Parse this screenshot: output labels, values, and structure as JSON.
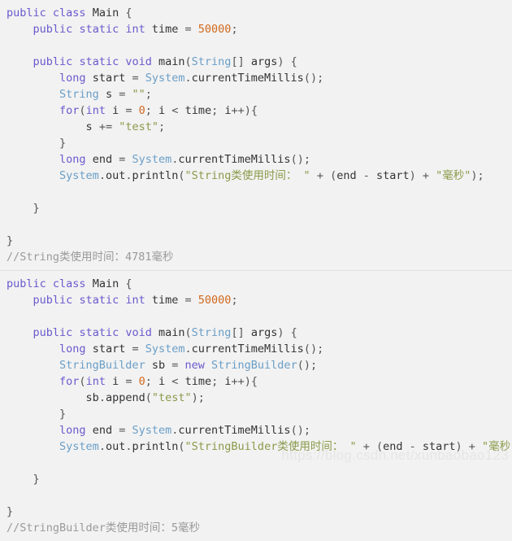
{
  "page": {
    "background_color": "#f2f2f2",
    "watermark": "https://blog.csdn.net/xunbaobao123"
  },
  "colors": {
    "keyword": "#6a5acd",
    "class_name": "#6a9ec7",
    "identifier": "#333333",
    "number": "#d2691e",
    "string": "#8a9a4a",
    "comment": "#9a9a9a",
    "punctuation": "#555555",
    "separator": "#e0e0e0"
  },
  "blocks": [
    {
      "id": "string-concat-example",
      "language": "java",
      "lines": [
        [
          {
            "t": "public",
            "c": "kw"
          },
          {
            "t": " ",
            "c": "pun"
          },
          {
            "t": "class",
            "c": "kw"
          },
          {
            "t": " ",
            "c": "pun"
          },
          {
            "t": "Main",
            "c": "id"
          },
          {
            "t": " {",
            "c": "pun"
          }
        ],
        [
          {
            "t": "    ",
            "c": "pun"
          },
          {
            "t": "public",
            "c": "kw"
          },
          {
            "t": " ",
            "c": "pun"
          },
          {
            "t": "static",
            "c": "kw"
          },
          {
            "t": " ",
            "c": "pun"
          },
          {
            "t": "int",
            "c": "kw"
          },
          {
            "t": " ",
            "c": "pun"
          },
          {
            "t": "time",
            "c": "id"
          },
          {
            "t": " = ",
            "c": "pun"
          },
          {
            "t": "50000",
            "c": "num"
          },
          {
            "t": ";",
            "c": "pun"
          }
        ],
        [
          {
            "t": "",
            "c": "pun"
          }
        ],
        [
          {
            "t": "    ",
            "c": "pun"
          },
          {
            "t": "public",
            "c": "kw"
          },
          {
            "t": " ",
            "c": "pun"
          },
          {
            "t": "static",
            "c": "kw"
          },
          {
            "t": " ",
            "c": "pun"
          },
          {
            "t": "void",
            "c": "kw"
          },
          {
            "t": " ",
            "c": "pun"
          },
          {
            "t": "main",
            "c": "id"
          },
          {
            "t": "(",
            "c": "pun"
          },
          {
            "t": "String",
            "c": "cls"
          },
          {
            "t": "[] ",
            "c": "pun"
          },
          {
            "t": "args",
            "c": "id"
          },
          {
            "t": ") {",
            "c": "pun"
          }
        ],
        [
          {
            "t": "        ",
            "c": "pun"
          },
          {
            "t": "long",
            "c": "kw"
          },
          {
            "t": " ",
            "c": "pun"
          },
          {
            "t": "start",
            "c": "id"
          },
          {
            "t": " = ",
            "c": "pun"
          },
          {
            "t": "System",
            "c": "cls"
          },
          {
            "t": ".",
            "c": "pun"
          },
          {
            "t": "currentTimeMillis",
            "c": "id"
          },
          {
            "t": "();",
            "c": "pun"
          }
        ],
        [
          {
            "t": "        ",
            "c": "pun"
          },
          {
            "t": "String",
            "c": "cls"
          },
          {
            "t": " ",
            "c": "pun"
          },
          {
            "t": "s",
            "c": "id"
          },
          {
            "t": " = ",
            "c": "pun"
          },
          {
            "t": "\"\"",
            "c": "str"
          },
          {
            "t": ";",
            "c": "pun"
          }
        ],
        [
          {
            "t": "        ",
            "c": "pun"
          },
          {
            "t": "for",
            "c": "kw"
          },
          {
            "t": "(",
            "c": "pun"
          },
          {
            "t": "int",
            "c": "kw"
          },
          {
            "t": " ",
            "c": "pun"
          },
          {
            "t": "i",
            "c": "id"
          },
          {
            "t": " = ",
            "c": "pun"
          },
          {
            "t": "0",
            "c": "num"
          },
          {
            "t": "; ",
            "c": "pun"
          },
          {
            "t": "i",
            "c": "id"
          },
          {
            "t": " < ",
            "c": "pun"
          },
          {
            "t": "time",
            "c": "id"
          },
          {
            "t": "; ",
            "c": "pun"
          },
          {
            "t": "i",
            "c": "id"
          },
          {
            "t": "++){",
            "c": "pun"
          }
        ],
        [
          {
            "t": "            ",
            "c": "pun"
          },
          {
            "t": "s",
            "c": "id"
          },
          {
            "t": " += ",
            "c": "pun"
          },
          {
            "t": "\"test\"",
            "c": "str"
          },
          {
            "t": ";",
            "c": "pun"
          }
        ],
        [
          {
            "t": "        }",
            "c": "pun"
          }
        ],
        [
          {
            "t": "        ",
            "c": "pun"
          },
          {
            "t": "long",
            "c": "kw"
          },
          {
            "t": " ",
            "c": "pun"
          },
          {
            "t": "end",
            "c": "id"
          },
          {
            "t": " = ",
            "c": "pun"
          },
          {
            "t": "System",
            "c": "cls"
          },
          {
            "t": ".",
            "c": "pun"
          },
          {
            "t": "currentTimeMillis",
            "c": "id"
          },
          {
            "t": "();",
            "c": "pun"
          }
        ],
        [
          {
            "t": "        ",
            "c": "pun"
          },
          {
            "t": "System",
            "c": "cls"
          },
          {
            "t": ".",
            "c": "pun"
          },
          {
            "t": "out",
            "c": "id"
          },
          {
            "t": ".",
            "c": "pun"
          },
          {
            "t": "println",
            "c": "id"
          },
          {
            "t": "(",
            "c": "pun"
          },
          {
            "t": "\"String类使用时间： \"",
            "c": "str"
          },
          {
            "t": " + (",
            "c": "pun"
          },
          {
            "t": "end",
            "c": "id"
          },
          {
            "t": " - ",
            "c": "pun"
          },
          {
            "t": "start",
            "c": "id"
          },
          {
            "t": ") + ",
            "c": "pun"
          },
          {
            "t": "\"毫秒\"",
            "c": "str"
          },
          {
            "t": ");",
            "c": "pun"
          }
        ],
        [
          {
            "t": "",
            "c": "pun"
          }
        ],
        [
          {
            "t": "    }",
            "c": "pun"
          }
        ],
        [
          {
            "t": "",
            "c": "pun"
          }
        ],
        [
          {
            "t": "}",
            "c": "pun"
          }
        ],
        [
          {
            "t": "//String类使用时间：4781毫秒",
            "c": "cmt"
          }
        ]
      ]
    },
    {
      "id": "stringbuilder-example",
      "language": "java",
      "lines": [
        [
          {
            "t": "public",
            "c": "kw"
          },
          {
            "t": " ",
            "c": "pun"
          },
          {
            "t": "class",
            "c": "kw"
          },
          {
            "t": " ",
            "c": "pun"
          },
          {
            "t": "Main",
            "c": "id"
          },
          {
            "t": " {",
            "c": "pun"
          }
        ],
        [
          {
            "t": "    ",
            "c": "pun"
          },
          {
            "t": "public",
            "c": "kw"
          },
          {
            "t": " ",
            "c": "pun"
          },
          {
            "t": "static",
            "c": "kw"
          },
          {
            "t": " ",
            "c": "pun"
          },
          {
            "t": "int",
            "c": "kw"
          },
          {
            "t": " ",
            "c": "pun"
          },
          {
            "t": "time",
            "c": "id"
          },
          {
            "t": " = ",
            "c": "pun"
          },
          {
            "t": "50000",
            "c": "num"
          },
          {
            "t": ";",
            "c": "pun"
          }
        ],
        [
          {
            "t": "",
            "c": "pun"
          }
        ],
        [
          {
            "t": "    ",
            "c": "pun"
          },
          {
            "t": "public",
            "c": "kw"
          },
          {
            "t": " ",
            "c": "pun"
          },
          {
            "t": "static",
            "c": "kw"
          },
          {
            "t": " ",
            "c": "pun"
          },
          {
            "t": "void",
            "c": "kw"
          },
          {
            "t": " ",
            "c": "pun"
          },
          {
            "t": "main",
            "c": "id"
          },
          {
            "t": "(",
            "c": "pun"
          },
          {
            "t": "String",
            "c": "cls"
          },
          {
            "t": "[] ",
            "c": "pun"
          },
          {
            "t": "args",
            "c": "id"
          },
          {
            "t": ") {",
            "c": "pun"
          }
        ],
        [
          {
            "t": "        ",
            "c": "pun"
          },
          {
            "t": "long",
            "c": "kw"
          },
          {
            "t": " ",
            "c": "pun"
          },
          {
            "t": "start",
            "c": "id"
          },
          {
            "t": " = ",
            "c": "pun"
          },
          {
            "t": "System",
            "c": "cls"
          },
          {
            "t": ".",
            "c": "pun"
          },
          {
            "t": "currentTimeMillis",
            "c": "id"
          },
          {
            "t": "();",
            "c": "pun"
          }
        ],
        [
          {
            "t": "        ",
            "c": "pun"
          },
          {
            "t": "StringBuilder",
            "c": "cls"
          },
          {
            "t": " ",
            "c": "pun"
          },
          {
            "t": "sb",
            "c": "id"
          },
          {
            "t": " = ",
            "c": "pun"
          },
          {
            "t": "new",
            "c": "kw"
          },
          {
            "t": " ",
            "c": "pun"
          },
          {
            "t": "StringBuilder",
            "c": "cls"
          },
          {
            "t": "();",
            "c": "pun"
          }
        ],
        [
          {
            "t": "        ",
            "c": "pun"
          },
          {
            "t": "for",
            "c": "kw"
          },
          {
            "t": "(",
            "c": "pun"
          },
          {
            "t": "int",
            "c": "kw"
          },
          {
            "t": " ",
            "c": "pun"
          },
          {
            "t": "i",
            "c": "id"
          },
          {
            "t": " = ",
            "c": "pun"
          },
          {
            "t": "0",
            "c": "num"
          },
          {
            "t": "; ",
            "c": "pun"
          },
          {
            "t": "i",
            "c": "id"
          },
          {
            "t": " < ",
            "c": "pun"
          },
          {
            "t": "time",
            "c": "id"
          },
          {
            "t": "; ",
            "c": "pun"
          },
          {
            "t": "i",
            "c": "id"
          },
          {
            "t": "++){",
            "c": "pun"
          }
        ],
        [
          {
            "t": "            ",
            "c": "pun"
          },
          {
            "t": "sb",
            "c": "id"
          },
          {
            "t": ".",
            "c": "pun"
          },
          {
            "t": "append",
            "c": "id"
          },
          {
            "t": "(",
            "c": "pun"
          },
          {
            "t": "\"test\"",
            "c": "str"
          },
          {
            "t": ");",
            "c": "pun"
          }
        ],
        [
          {
            "t": "        }",
            "c": "pun"
          }
        ],
        [
          {
            "t": "        ",
            "c": "pun"
          },
          {
            "t": "long",
            "c": "kw"
          },
          {
            "t": " ",
            "c": "pun"
          },
          {
            "t": "end",
            "c": "id"
          },
          {
            "t": " = ",
            "c": "pun"
          },
          {
            "t": "System",
            "c": "cls"
          },
          {
            "t": ".",
            "c": "pun"
          },
          {
            "t": "currentTimeMillis",
            "c": "id"
          },
          {
            "t": "();",
            "c": "pun"
          }
        ],
        [
          {
            "t": "        ",
            "c": "pun"
          },
          {
            "t": "System",
            "c": "cls"
          },
          {
            "t": ".",
            "c": "pun"
          },
          {
            "t": "out",
            "c": "id"
          },
          {
            "t": ".",
            "c": "pun"
          },
          {
            "t": "println",
            "c": "id"
          },
          {
            "t": "(",
            "c": "pun"
          },
          {
            "t": "\"StringBuilder类使用时间： \"",
            "c": "str"
          },
          {
            "t": " + (",
            "c": "pun"
          },
          {
            "t": "end",
            "c": "id"
          },
          {
            "t": " - ",
            "c": "pun"
          },
          {
            "t": "start",
            "c": "id"
          },
          {
            "t": ") + ",
            "c": "pun"
          },
          {
            "t": "\"毫秒\"",
            "c": "str"
          },
          {
            "t": ");",
            "c": "pun"
          }
        ],
        [
          {
            "t": "",
            "c": "pun"
          }
        ],
        [
          {
            "t": "    }",
            "c": "pun"
          }
        ],
        [
          {
            "t": "",
            "c": "pun"
          }
        ],
        [
          {
            "t": "}",
            "c": "pun"
          }
        ],
        [
          {
            "t": "//StringBuilder类使用时间：5毫秒",
            "c": "cmt"
          }
        ]
      ]
    }
  ]
}
